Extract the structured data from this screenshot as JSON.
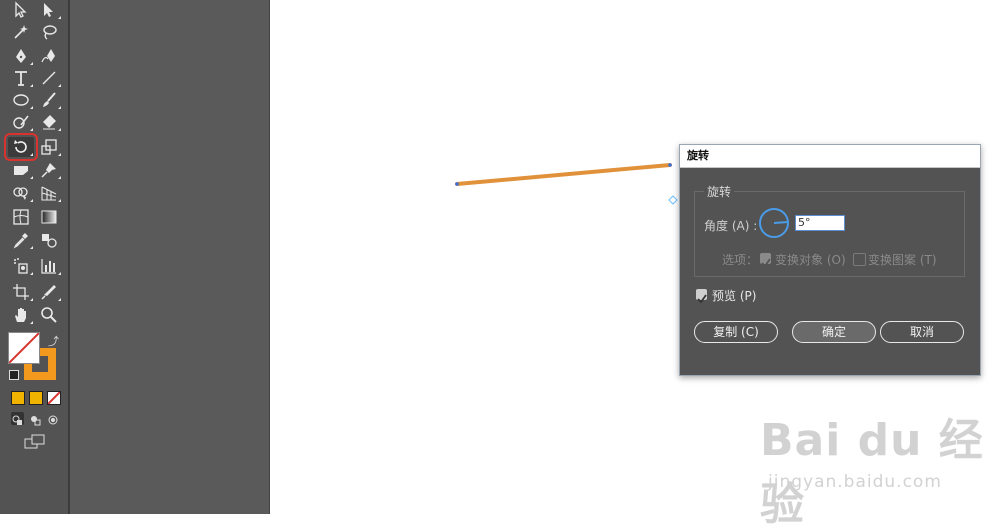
{
  "toolbar": {
    "tools": [
      {
        "name": "selection-tool",
        "glyph": "▷"
      },
      {
        "name": "direct-selection-tool",
        "glyph": "▶"
      },
      {
        "name": "magic-wand-tool",
        "glyph": "✦"
      },
      {
        "name": "lasso-tool",
        "glyph": "ℒ"
      },
      {
        "name": "pen-tool",
        "glyph": "✒"
      },
      {
        "name": "curvature-tool",
        "glyph": "✎"
      },
      {
        "name": "type-tool",
        "glyph": "T"
      },
      {
        "name": "line-tool",
        "glyph": "╱"
      },
      {
        "name": "ellipse-tool",
        "glyph": "◯"
      },
      {
        "name": "paintbrush-tool",
        "glyph": "🖌"
      },
      {
        "name": "shaper-tool",
        "glyph": "✐"
      },
      {
        "name": "eraser-tool",
        "glyph": "◆"
      },
      {
        "name": "rotate-tool",
        "glyph": "↺"
      },
      {
        "name": "scale-tool",
        "glyph": "⤢"
      },
      {
        "name": "warp-tool",
        "glyph": "▭"
      },
      {
        "name": "puppet-warp-tool",
        "glyph": "✱"
      },
      {
        "name": "shape-builder-tool",
        "glyph": "⊕"
      },
      {
        "name": "perspective-grid-tool",
        "glyph": "⊿"
      },
      {
        "name": "mesh-tool",
        "glyph": "⊞"
      },
      {
        "name": "gradient-tool",
        "glyph": "▣"
      },
      {
        "name": "eyedropper-tool",
        "glyph": "✐"
      },
      {
        "name": "blend-tool",
        "glyph": "◎"
      },
      {
        "name": "symbol-sprayer-tool",
        "glyph": "⁂"
      },
      {
        "name": "column-graph-tool",
        "glyph": "▥"
      },
      {
        "name": "artboard-tool",
        "glyph": "⊡"
      },
      {
        "name": "slice-tool",
        "glyph": "✂"
      },
      {
        "name": "hand-tool",
        "glyph": "✋"
      },
      {
        "name": "zoom-tool",
        "glyph": "⌕"
      }
    ]
  },
  "colors": {
    "fill": "#ffffff",
    "stroke": "#f39a1e",
    "accent_swatch": "#f0b400"
  },
  "canvas": {
    "line_color": "#e0913a"
  },
  "dialog": {
    "title": "旋转",
    "group_title": "旋转",
    "angle_label": "角度",
    "angle_shortcut": "(A)",
    "angle_colon": ":",
    "angle_value": "5°",
    "options_label": "选项：",
    "transform_objects_label": "变换对象",
    "transform_objects_shortcut": "(O)",
    "transform_patterns_label": "变换图案",
    "transform_patterns_shortcut": "(T)",
    "preview_label": "预览",
    "preview_shortcut": "(P)",
    "copy_button": "复制 (C)",
    "ok_button": "确定",
    "cancel_button": "取消"
  },
  "watermark": {
    "brand": "Bai du 经验",
    "url": "jingyan.baidu.com"
  }
}
